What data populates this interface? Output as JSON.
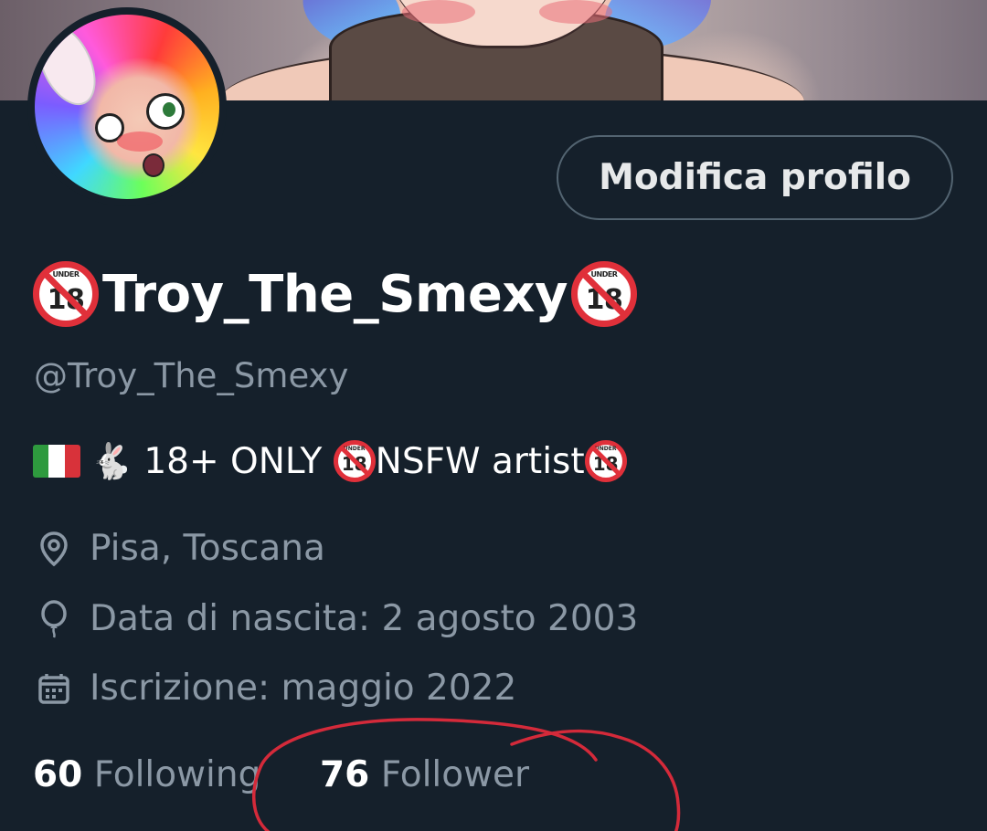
{
  "profile": {
    "display_name": "Troy_The_Smexy",
    "handle": "@Troy_The_Smexy",
    "edit_button_label": "Modifica profilo",
    "badge_text": "UNDER",
    "badge_number": "18",
    "bio_text_1": "18+ ONLY ",
    "bio_text_2": "NSFW artist",
    "bunny_emoji": "🐇",
    "location": "Pisa, Toscana",
    "birthday": "Data di nascita: 2 agosto 2003",
    "joined": "Iscrizione: maggio 2022",
    "following_count": "60",
    "following_label": "Following",
    "follower_count": "76",
    "follower_label": "Follower"
  },
  "colors": {
    "background": "#15202b",
    "secondary_text": "#8b98a5",
    "annotation_red": "#d42a3a"
  },
  "icons": {
    "location": "location-pin-icon",
    "birthday": "balloon-icon",
    "joined": "calendar-icon"
  }
}
